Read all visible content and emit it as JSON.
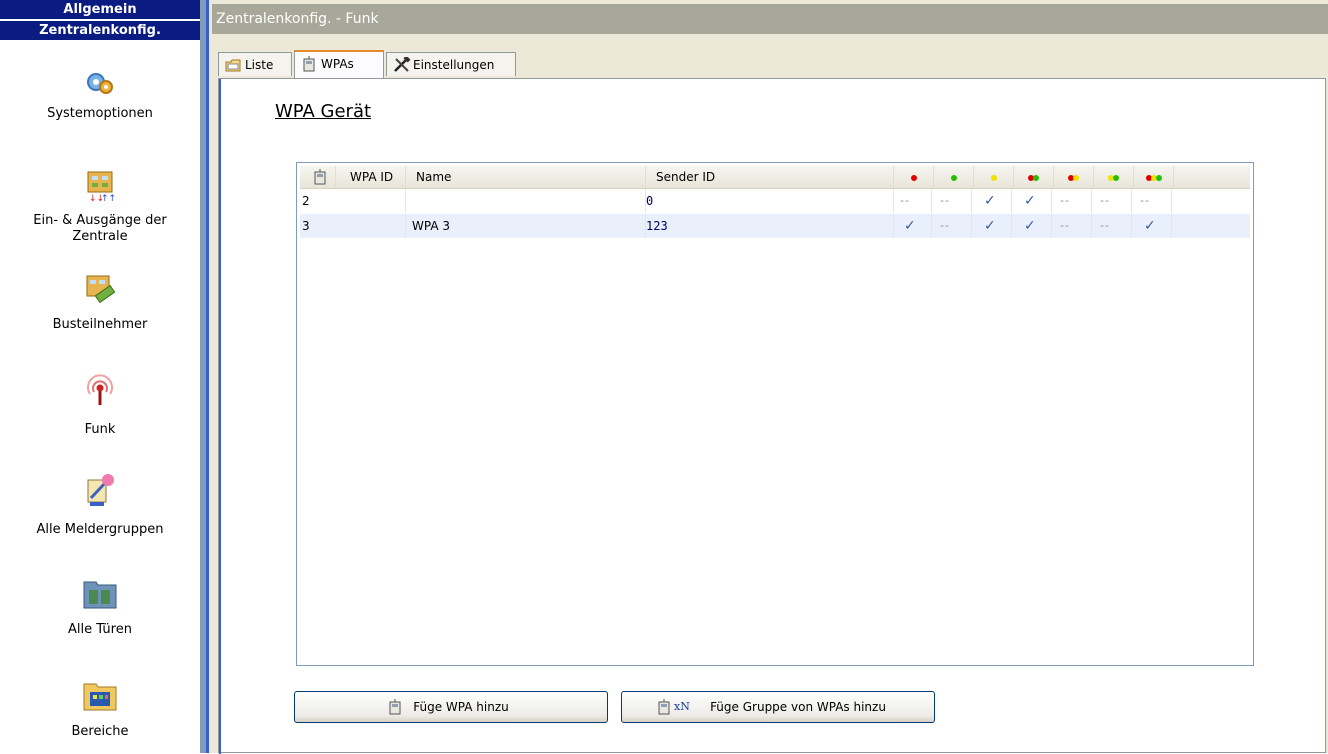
{
  "sidebar": {
    "header_general": "Allgemein",
    "header_config": "Zentralenkonfig.",
    "items": [
      {
        "label": "Systemoptionen",
        "icon": "gears-icon"
      },
      {
        "label_line1": "Ein- & Ausgänge der",
        "label_line2": "Zentrale",
        "icon": "io-board-icon"
      },
      {
        "label": "Busteilnehmer",
        "icon": "bus-module-icon"
      },
      {
        "label": "Funk",
        "icon": "radio-antenna-icon"
      },
      {
        "label": "Alle Meldergruppen",
        "icon": "detector-group-icon"
      },
      {
        "label": "Alle Türen",
        "icon": "doors-icon"
      },
      {
        "label": "Bereiche",
        "icon": "areas-icon"
      }
    ]
  },
  "window": {
    "title": "Zentralenkonfig. - Funk"
  },
  "tabs": [
    {
      "label": "Liste",
      "icon": "list-icon"
    },
    {
      "label": "WPAs",
      "icon": "wpa-device-icon",
      "active": true
    },
    {
      "label": "Einstellungen",
      "icon": "tools-icon"
    }
  ],
  "section": {
    "title": "WPA Gerät"
  },
  "table": {
    "columns": [
      "WPA ID",
      "Name",
      "Sender ID"
    ],
    "status_columns": [
      {
        "name": "red",
        "colors": [
          "#e00000"
        ]
      },
      {
        "name": "green",
        "colors": [
          "#22c000"
        ]
      },
      {
        "name": "yellow",
        "colors": [
          "#f2e000"
        ]
      },
      {
        "name": "red-green",
        "colors": [
          "#e00000",
          "#22c000"
        ]
      },
      {
        "name": "red-yellow",
        "colors": [
          "#e00000",
          "#f2e000"
        ]
      },
      {
        "name": "yellow-green",
        "colors": [
          "#f2e000",
          "#22c000"
        ]
      },
      {
        "name": "red-yellow-green",
        "colors": [
          "#e00000",
          "#f2e000",
          "#22c000"
        ]
      }
    ],
    "rows": [
      {
        "wpa_id": "2",
        "name": "",
        "sender_id": "0",
        "status": [
          "--",
          "--",
          "✓",
          "✓",
          "--",
          "--",
          "--"
        ]
      },
      {
        "wpa_id": "3",
        "name": "WPA 3",
        "sender_id": "123",
        "status": [
          "✓",
          "--",
          "✓",
          "✓",
          "--",
          "--",
          "✓"
        ]
      }
    ]
  },
  "buttons": {
    "add_wpa": "Füge WPA hinzu",
    "add_group_prefix": "xN",
    "add_group": "Füge Gruppe von WPAs hinzu"
  }
}
